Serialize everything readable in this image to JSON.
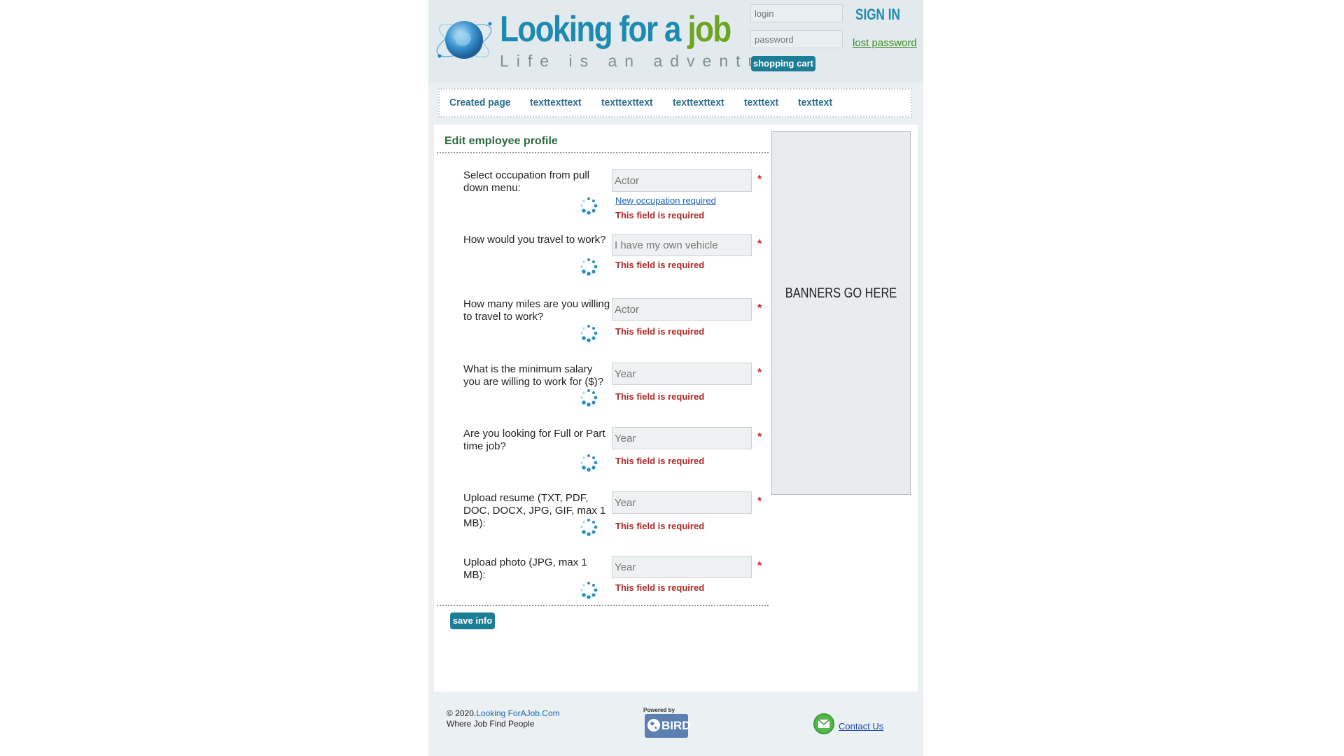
{
  "header": {
    "logo_title_part1": "Looking for a ",
    "logo_title_part2": "job",
    "tagline": "Life is an adventure",
    "login_placeholder": "login",
    "password_placeholder": "password",
    "sign_in": "SIGN IN",
    "lost_password": "lost password",
    "shopping_cart": "shopping cart"
  },
  "nav": {
    "items": [
      {
        "label": "Created page"
      },
      {
        "label": "texttexttext"
      },
      {
        "label": "texttexttext"
      },
      {
        "label": "texttexttext"
      },
      {
        "label": "texttext"
      },
      {
        "label": "texttext"
      }
    ]
  },
  "form": {
    "title": "Edit employee profile",
    "required_marker": "*",
    "error_text": "This field is required",
    "fields": [
      {
        "label": "Select occupation from pull down menu:",
        "value": "Actor",
        "extra_link": "New occupation required"
      },
      {
        "label": "How would you travel to work?",
        "value": "I have my own vehicle"
      },
      {
        "label": "How many miles are you willing to travel to work?",
        "value": "Actor"
      },
      {
        "label": "What is the minimum salary you are willing to work for ($)?",
        "value": "Year"
      },
      {
        "label": "Are you looking for Full or Part time job?",
        "value": "Year"
      },
      {
        "label": "Upload resume (TXT, PDF, DOC, DOCX, JPG, GIF, max 1 MB):",
        "value": "Year"
      },
      {
        "label": "Upload photo (JPG, max 1 MB):",
        "value": "Year"
      }
    ],
    "save_button": "save info"
  },
  "banner": {
    "text": "BANNERS GO HERE"
  },
  "footer": {
    "copyright_prefix": "© 2020.",
    "copyright_site": "Looking ForAJob.Com",
    "slogan": "Where Job Find People",
    "powered_by_label": "Powered by",
    "powered_by_brand": "BIRD",
    "contact": "Contact Us"
  },
  "colors": {
    "brand_blue": "#1e8ab0",
    "brand_green": "#6ea51f",
    "button_teal": "#1b7d96",
    "error_red": "#b02828"
  }
}
